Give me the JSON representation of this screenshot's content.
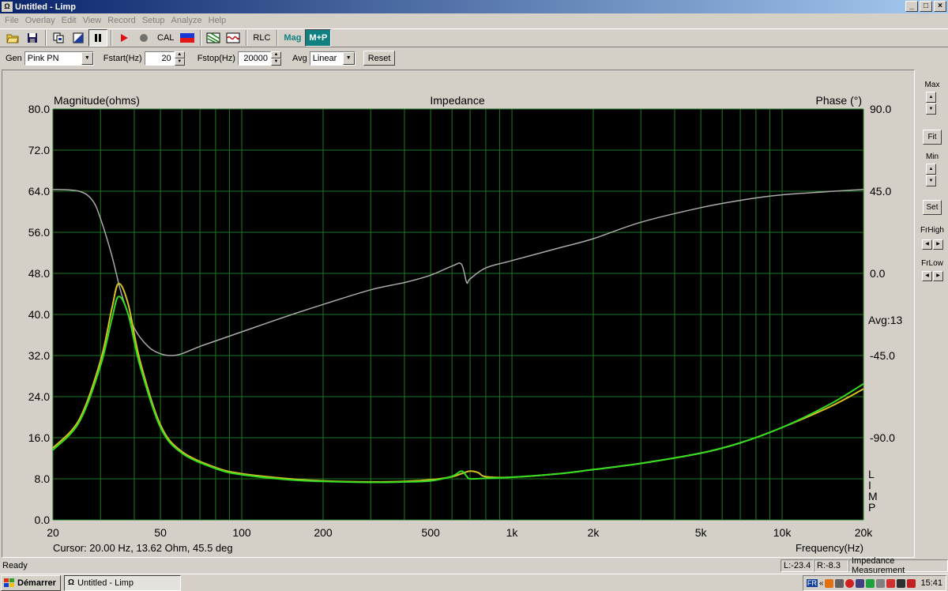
{
  "window": {
    "title": "Untitled - Limp",
    "minimize": "_",
    "maximize": "□",
    "close": "×"
  },
  "menu": [
    "File",
    "Overlay",
    "Edit",
    "View",
    "Record",
    "Setup",
    "Analyze",
    "Help"
  ],
  "toolbar": {
    "cal": "CAL",
    "rlc": "RLC",
    "mag": "Mag",
    "mp": "M+P"
  },
  "genbar": {
    "gen_label": "Gen",
    "gen_value": "Pink PN",
    "fstart_label": "Fstart(Hz)",
    "fstart_value": "20",
    "fstop_label": "Fstop(Hz)",
    "fstop_value": "20000",
    "avg_label": "Avg",
    "avg_value": "Linear",
    "reset": "Reset"
  },
  "graph": {
    "title": "Impedance",
    "left_label": "Magnitude(ohms)",
    "right_label": "Phase (°)",
    "avg": "Avg:13",
    "side_letters": [
      "L",
      "I",
      "M",
      "P"
    ],
    "cursor": "Cursor: 20.00 Hz, 13.62 Ohm, 45.5 deg",
    "freq_label": "Frequency(Hz)"
  },
  "side": {
    "max": "Max",
    "fit": "Fit",
    "min": "Min",
    "set": "Set",
    "frhigh": "FrHigh",
    "frlow": "FrLow"
  },
  "status": {
    "ready": "Ready",
    "l": "L:-23.4",
    "r": "R:-8.3",
    "mode": "Impedance Measurement"
  },
  "taskbar": {
    "start": "Démarrer",
    "task": "Untitled - Limp",
    "lang": "FR",
    "clock": "15:41"
  },
  "colors": {
    "plot_bg": "#000000",
    "grid": "#1f7a1f",
    "magnitude_green": "#33dd22",
    "magnitude_yellow": "#d8c020",
    "phase": "#aaaaaa"
  },
  "chart_data": {
    "type": "line",
    "title": "Impedance",
    "xlabel": "Frequency(Hz)",
    "ylabel": "Magnitude(ohms)",
    "y2label": "Phase (°)",
    "xscale": "log",
    "xlim": [
      20,
      20000
    ],
    "ylim": [
      0,
      80
    ],
    "y2lim": [
      -135,
      90
    ],
    "x_ticks": [
      "20",
      "50",
      "100",
      "200",
      "500",
      "1k",
      "2k",
      "5k",
      "10k",
      "20k"
    ],
    "x_tick_values": [
      20,
      50,
      100,
      200,
      500,
      1000,
      2000,
      5000,
      10000,
      20000
    ],
    "y_ticks": [
      "0.0",
      "8.0",
      "16.0",
      "24.0",
      "32.0",
      "40.0",
      "48.0",
      "56.0",
      "64.0",
      "72.0",
      "80.0"
    ],
    "y2_ticks": [
      "-90.0",
      "-45.0",
      "0.0",
      "45.0",
      "90.0"
    ],
    "grid": true,
    "series": [
      {
        "axis": "left",
        "color": "#33dd22",
        "x": [
          20,
          25,
          30,
          33,
          35,
          38,
          42,
          50,
          60,
          80,
          100,
          150,
          200,
          300,
          400,
          500,
          600,
          650,
          680,
          700,
          800,
          1000,
          1500,
          2000,
          3000,
          5000,
          7000,
          10000,
          15000,
          20000
        ],
        "y": [
          13.6,
          19,
          30,
          39,
          43.5,
          40,
          30,
          18,
          13,
          10,
          8.8,
          7.8,
          7.5,
          7.3,
          7.4,
          7.6,
          8.5,
          9.5,
          8.5,
          8.0,
          8.1,
          8.3,
          9,
          9.8,
          11,
          13,
          15,
          18,
          22.5,
          26.5
        ]
      },
      {
        "axis": "left",
        "color": "#d8c020",
        "x": [
          20,
          25,
          30,
          33,
          35,
          38,
          42,
          50,
          60,
          80,
          100,
          150,
          200,
          300,
          400,
          500,
          600,
          650,
          700,
          750,
          800,
          1000,
          1500,
          2000,
          3000,
          5000,
          7000,
          10000,
          15000,
          20000
        ],
        "y": [
          14,
          19.5,
          31,
          41,
          46,
          42,
          31,
          18.5,
          13.3,
          10.2,
          9,
          8,
          7.6,
          7.4,
          7.5,
          7.8,
          8.4,
          9.0,
          9.5,
          9.2,
          8.4,
          8.3,
          9,
          9.8,
          11,
          13,
          15,
          18,
          22,
          25.5
        ]
      },
      {
        "axis": "right",
        "color": "#aaaaaa",
        "x": [
          20,
          25,
          28,
          30,
          33,
          36,
          40,
          45,
          50,
          55,
          60,
          70,
          80,
          100,
          150,
          200,
          300,
          400,
          500,
          600,
          650,
          680,
          700,
          800,
          1000,
          1500,
          2000,
          3000,
          5000,
          7000,
          10000,
          20000
        ],
        "y": [
          46,
          45,
          40,
          30,
          10,
          -12,
          -30,
          -40,
          -44,
          -45,
          -44,
          -40,
          -37,
          -32,
          -23,
          -17,
          -9,
          -5,
          -1,
          4,
          5,
          -5,
          -3,
          3,
          7,
          14,
          19,
          28,
          36,
          40,
          43,
          46
        ]
      }
    ]
  }
}
